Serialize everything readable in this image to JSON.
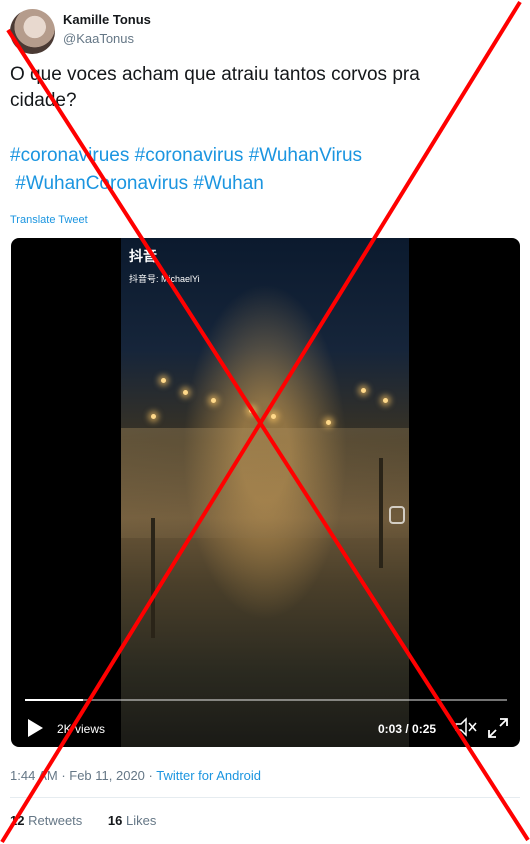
{
  "user": {
    "name": "Kamille Tonus",
    "handle": "@KaaTonus"
  },
  "tweet": {
    "text": "O que voces acham que atraiu tantos corvos pra cidade?",
    "hashtags": [
      "#coronavirues",
      "#coronavirus",
      "#WuhanVirus",
      "#WuhanCoronavirus",
      "#Wuhan"
    ],
    "translate_label": "Translate Tweet"
  },
  "video": {
    "watermark_logo": "抖音",
    "watermark_id": "抖音号: MichaelYi",
    "progress": 0.12,
    "views": "2K views",
    "time": "0:03 / 0:25",
    "icons": {
      "play": "play-icon",
      "volume": "volume-muted-icon",
      "fullscreen": "fullscreen-icon"
    }
  },
  "meta": {
    "time": "1:44 AM",
    "sep": " · ",
    "date": "Feb 11, 2020",
    "source": "Twitter for Android"
  },
  "stats": {
    "retweets_count": "12",
    "retweets_label": "Retweets",
    "likes_count": "16",
    "likes_label": "Likes"
  },
  "colors": {
    "link": "#1b95e0",
    "cross": "#ff0000"
  }
}
